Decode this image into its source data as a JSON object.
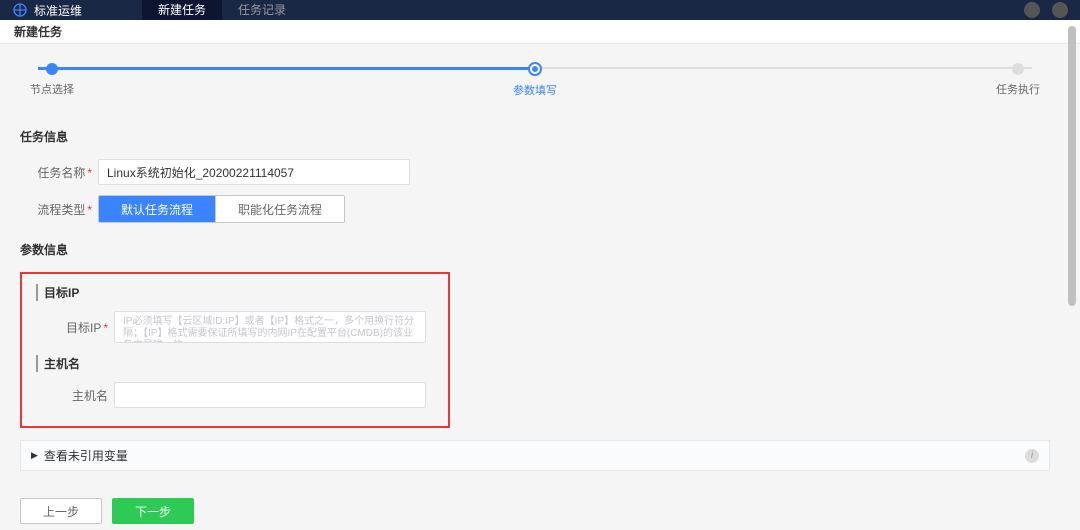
{
  "topbar": {
    "brand": "标准运维",
    "tabs": [
      {
        "label": "新建任务",
        "active": true
      },
      {
        "label": "任务记录",
        "active": false
      }
    ]
  },
  "breadcrumb": "新建任务",
  "steps": [
    {
      "label": "节点选择"
    },
    {
      "label": "参数填写"
    },
    {
      "label": "任务执行"
    }
  ],
  "sections": {
    "task_info": {
      "title": "任务信息",
      "task_name": {
        "label": "任务名称",
        "value": "Linux系统初始化_20200221114057"
      },
      "flow_type": {
        "label": "流程类型",
        "options": [
          {
            "label": "默认任务流程",
            "active": true
          },
          {
            "label": "职能化任务流程",
            "active": false
          }
        ]
      }
    },
    "param_info": {
      "title": "参数信息",
      "target_ip": {
        "group_title": "目标IP",
        "field_label": "目标IP",
        "placeholder": "IP必须填写【云区域ID:IP】或者【IP】格式之一，多个用换行符分隔；【IP】格式需要保证所填写的内网IP在配置平台(CMDB)的该业务中是唯一的"
      },
      "hostname": {
        "group_title": "主机名",
        "field_label": "主机名"
      }
    },
    "unreferenced_vars": {
      "title": "查看未引用变量"
    }
  },
  "footer": {
    "prev": "上一步",
    "next": "下一步"
  }
}
